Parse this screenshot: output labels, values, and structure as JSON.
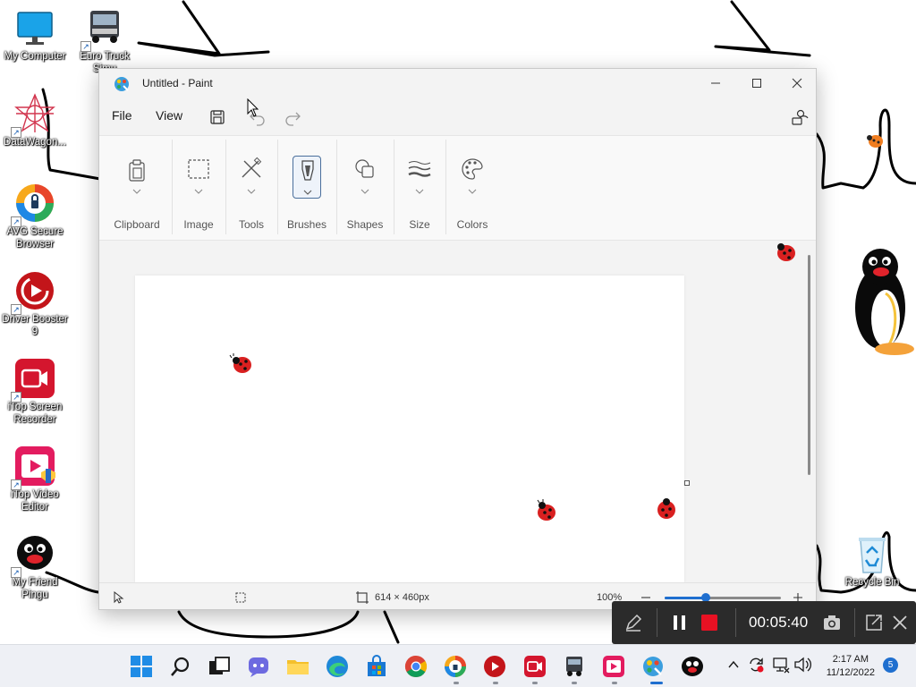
{
  "desktop": {
    "icons": [
      {
        "label": "My Computer"
      },
      {
        "label": "Euro Truck Simu"
      },
      {
        "label": "DataWagon..."
      },
      {
        "label": "AVG Secure Browser"
      },
      {
        "label": "Driver Booster 9"
      },
      {
        "label": "iTop Screen Recorder"
      },
      {
        "label": "iTop Video Editor"
      },
      {
        "label": "My Friend Pingu"
      },
      {
        "label": "Recycle Bin"
      }
    ]
  },
  "paint": {
    "title": "Untitled - Paint",
    "menu": {
      "file": "File",
      "view": "View"
    },
    "ribbon": {
      "clipboard": "Clipboard",
      "image": "Image",
      "tools": "Tools",
      "brushes": "Brushes",
      "shapes": "Shapes",
      "size": "Size",
      "colors": "Colors"
    },
    "status": {
      "canvas_size": "614 × 460px",
      "zoom": "100%",
      "zoom_fraction": 0.35
    }
  },
  "recorder": {
    "time": "00:05:40"
  },
  "taskbar": {
    "time": "2:17 AM",
    "date": "11/12/2022",
    "notifications": "5"
  },
  "colors": {
    "accent": "#1f6fcf",
    "record": "#e81123",
    "recorder_bg": "#2b2b2b"
  }
}
